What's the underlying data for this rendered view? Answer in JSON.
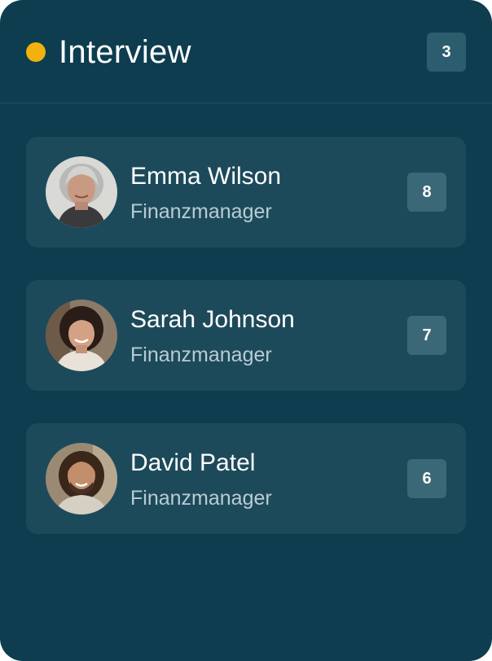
{
  "column": {
    "title": "Interview",
    "count": "3",
    "status_color": "#f2b20d"
  },
  "cards": [
    {
      "name": "Emma Wilson",
      "role": "Finanzmanager",
      "score": "8",
      "avatar": "avatar-elderly-woman-gray-hair"
    },
    {
      "name": "Sarah Johnson",
      "role": "Finanzmanager",
      "score": "7",
      "avatar": "avatar-woman-dark-hair"
    },
    {
      "name": "David Patel",
      "role": "Finanzmanager",
      "score": "6",
      "avatar": "avatar-man-long-hair-beard"
    }
  ]
}
